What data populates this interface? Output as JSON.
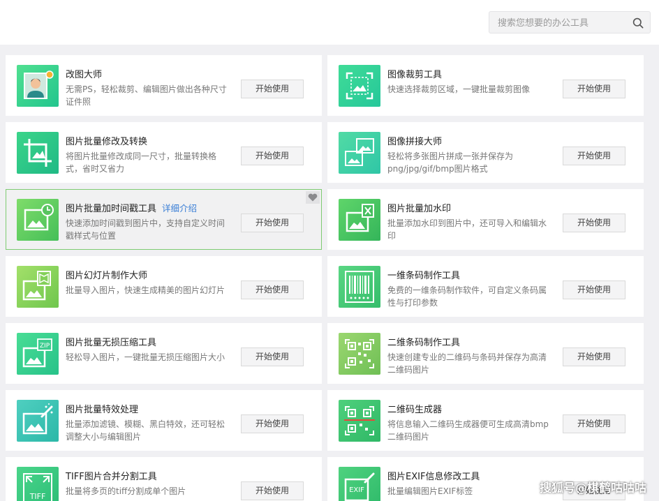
{
  "search": {
    "placeholder": "搜索您想要的办公工具"
  },
  "start_label": "开始使用",
  "tools": [
    {
      "title": "改图大师",
      "desc": "无需PS，轻松裁剪、编辑图片做出各种尺寸证件照",
      "icon": "portrait-icon"
    },
    {
      "title": "图像裁剪工具",
      "desc": "快速选择裁剪区域，一键批量裁剪图像",
      "icon": "crop-frame-icon"
    },
    {
      "title": "图片批量修改及转换",
      "desc": "将图片批量修改成同一尺寸，批量转换格式，省时又省力",
      "icon": "crop-tool-icon"
    },
    {
      "title": "图像拼接大师",
      "desc": "轻松将多张图片拼成一张并保存为png/jpg/gif/bmp图片格式",
      "icon": "image-stack-icon"
    },
    {
      "title": "图片批量加时间戳工具",
      "link": "详细介绍",
      "desc": "快速添加时间戳到图片中，支持自定义时间戳样式与位置",
      "icon": "clock-image-icon"
    },
    {
      "title": "图片批量加水印",
      "desc": "批量添加水印到图片中，还可导入和编辑水印",
      "icon": "watermark-image-icon"
    },
    {
      "title": "图片幻灯片制作大师",
      "desc": "批量导入图片，快速生成精美的图片幻灯片",
      "icon": "slideshow-icon"
    },
    {
      "title": "一维条码制作工具",
      "desc": "免费的一维条码制作软件，可自定义条码属性与打印参数",
      "icon": "barcode-icon"
    },
    {
      "title": "图片批量无损压缩工具",
      "desc": "轻松导入图片，一键批量无损压缩图片大小",
      "icon": "zip-image-icon"
    },
    {
      "title": "二维条码制作工具",
      "desc": "快速创建专业的二维码与条码并保存为高清二维码图片",
      "icon": "qr-barcode-icon"
    },
    {
      "title": "图片批量特效处理",
      "desc": "批量添加滤镜、模糊、黑白特效，还可轻松调整大小与编辑图片",
      "icon": "magic-image-icon"
    },
    {
      "title": "二维码生成器",
      "desc": "将信息输入二维码生成器便可生成高清bmp二维码图片",
      "icon": "qr-generator-icon"
    },
    {
      "title": "TIFF图片合并分割工具",
      "desc": "批量将多页的tiff分割成单个图片",
      "icon": "tiff-icon"
    },
    {
      "title": "图片EXIF信息修改工具",
      "desc": "批量编辑图片EXIF标签",
      "icon": "exif-icon"
    }
  ],
  "watermark": "搜狐号@棋鹤咕咕咕",
  "colors": {
    "accent_green": "#49d08c",
    "link_blue": "#3b7fd6",
    "active_border": "#7ecb72"
  }
}
